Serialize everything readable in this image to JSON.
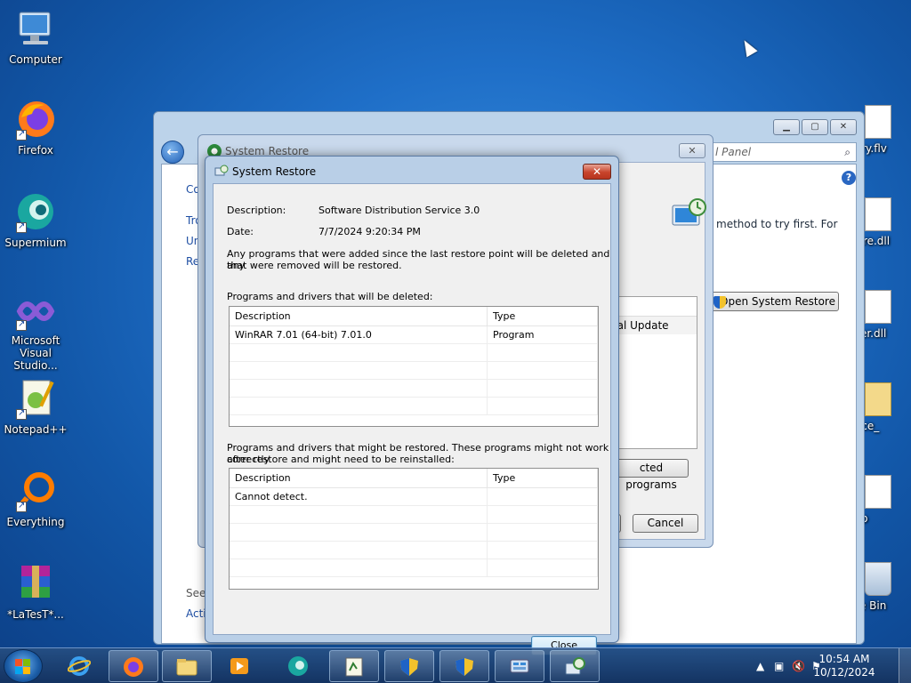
{
  "desktop": {
    "icons": [
      {
        "label": "Computer"
      },
      {
        "label": "Firefox"
      },
      {
        "label": "Supermium"
      },
      {
        "label": "Microsoft Visual Studio..."
      },
      {
        "label": "Notepad++"
      },
      {
        "label": "Everything"
      },
      {
        "label": "*LaTesT*..."
      }
    ],
    "right_icons": [
      {
        "label": "erry.flv"
      },
      {
        "label": "core.dll"
      },
      {
        "label": "ster.dll"
      },
      {
        "label": "urce_"
      },
      {
        "label": "-up"
      },
      {
        "label": "cle Bin"
      }
    ]
  },
  "control_panel": {
    "address": "l Panel",
    "left_links": [
      "Co",
      "Tro",
      "Un",
      "Re"
    ],
    "see_also": "See",
    "action": "Acti",
    "text_right": "method to try first. For",
    "open_restore": "Open System Restore"
  },
  "wizard": {
    "title": "System Restore",
    "list_header": "e",
    "list_row": "cal Update",
    "affected_btn": "cted programs",
    "cancel": "Cancel"
  },
  "dialog": {
    "title": "System Restore",
    "description_label": "Description:",
    "description_value": "Software Distribution Service 3.0",
    "date_label": "Date:",
    "date_value": "7/7/2024 9:20:34 PM",
    "info_text_1": "Any programs that were added since the last restore point will be deleted and any",
    "info_text_2": "that were removed will be restored.",
    "deleted_label": "Programs and drivers that will be deleted:",
    "deleted_columns": [
      "Description",
      "Type"
    ],
    "deleted_rows": [
      {
        "description": "WinRAR 7.01 (64-bit) 7.01.0",
        "type": "Program"
      }
    ],
    "restored_label_1": "Programs and drivers that might be restored. These programs might not work correctly",
    "restored_label_2": "after restore and might need to be reinstalled:",
    "restored_columns": [
      "Description",
      "Type"
    ],
    "restored_rows": [
      {
        "description": "Cannot detect.",
        "type": ""
      }
    ],
    "close_label": "Close"
  },
  "taskbar": {
    "clock_time": "10:54 AM",
    "clock_date": "10/12/2024"
  },
  "colors": {
    "desktop_bg": "#1f6fc8",
    "dialog_close_red": "#c7432b",
    "taskbar": "#1c3f6e"
  }
}
